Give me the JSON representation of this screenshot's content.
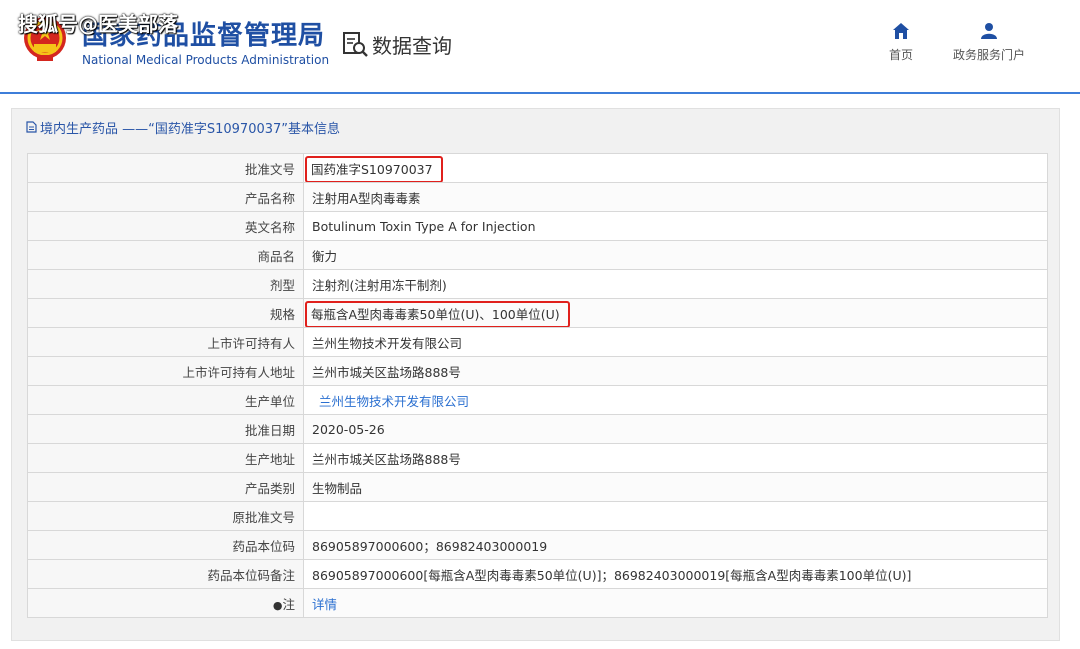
{
  "watermark": "搜狐号@医美部落",
  "header": {
    "org_name_cn": "国家药品监督管理局",
    "org_name_en": "National Medical Products Administration",
    "data_query_label": "数据查询",
    "nav": [
      {
        "label": "首页",
        "icon": "home-icon"
      },
      {
        "label": "政务服务门户",
        "icon": "user-icon"
      }
    ]
  },
  "colors": {
    "brand": "#1f4fa3",
    "link": "#2a6fd0",
    "highlight": "#e0201c",
    "header_line": "#3d7ed9"
  },
  "panel": {
    "title": "境内生产药品 ——“国药准字S10970037”基本信息"
  },
  "rows": [
    {
      "label": "批准文号",
      "value": "国药准字S10970037"
    },
    {
      "label": "产品名称",
      "value": "注射用A型肉毒毒素"
    },
    {
      "label": "英文名称",
      "value": "Botulinum Toxin Type A for Injection"
    },
    {
      "label": "商品名",
      "value": "衡力"
    },
    {
      "label": "剂型",
      "value": "注射剂(注射用冻干制剂)"
    },
    {
      "label": "规格",
      "value": "每瓶含A型肉毒毒素50单位(U)、100单位(U)"
    },
    {
      "label": "上市许可持有人",
      "value": "兰州生物技术开发有限公司"
    },
    {
      "label": "上市许可持有人地址",
      "value": "兰州市城关区盐场路888号"
    },
    {
      "label": "生产单位",
      "value": "兰州生物技术开发有限公司"
    },
    {
      "label": "批准日期",
      "value": "2020-05-26"
    },
    {
      "label": "生产地址",
      "value": "兰州市城关区盐场路888号"
    },
    {
      "label": "产品类别",
      "value": "生物制品"
    },
    {
      "label": "原批准文号",
      "value": ""
    },
    {
      "label": "药品本位码",
      "value": "86905897000600；86982403000019"
    },
    {
      "label": "药品本位码备注",
      "value": "86905897000600[每瓶含A型肉毒毒素50单位(U)]；86982403000019[每瓶含A型肉毒毒素100单位(U)]"
    },
    {
      "label": "注",
      "value": "详情"
    }
  ]
}
